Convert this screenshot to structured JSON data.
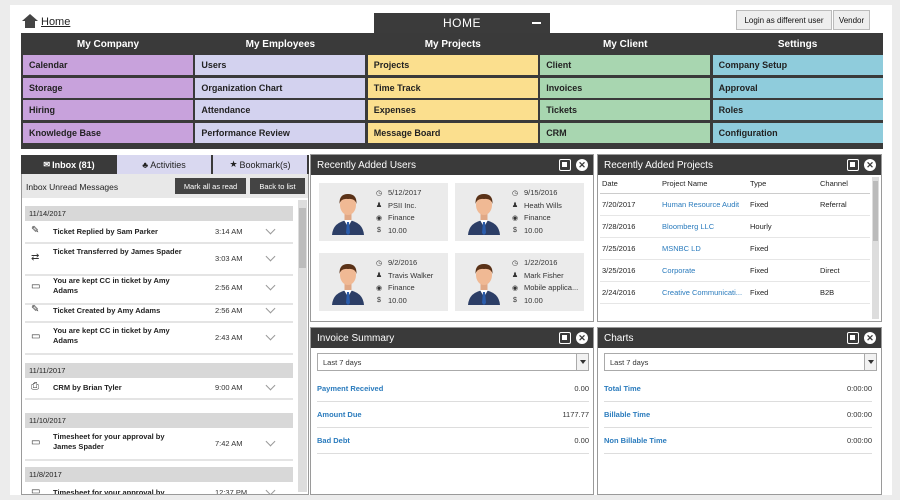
{
  "header": {
    "home_link": "Home",
    "home_tab": "HOME",
    "login_button": "Login as different user",
    "vendor_button": "Vendor"
  },
  "nav": {
    "columns": [
      {
        "title": "My Company",
        "color": "#c8a2dc",
        "items": [
          "Calendar",
          "Storage",
          "Hiring",
          "Knowledge Base"
        ]
      },
      {
        "title": "My Employees",
        "color": "#d3d2ef",
        "items": [
          "Users",
          "Organization Chart",
          "Attendance",
          "Performance Review"
        ]
      },
      {
        "title": "My Projects",
        "color": "#fbdf8e",
        "items": [
          "Projects",
          "Time Track",
          "Expenses",
          "Message Board"
        ]
      },
      {
        "title": "My Client",
        "color": "#a8d6b0",
        "items": [
          "Client",
          "Invoices",
          "Tickets",
          "CRM"
        ]
      },
      {
        "title": "Settings",
        "color": "#8fccdc",
        "items": [
          "Company Setup",
          "Approval",
          "Roles",
          "Configuration"
        ]
      }
    ]
  },
  "inbox": {
    "tabs": [
      "Inbox (81)",
      "Activities",
      "Bookmark(s)"
    ],
    "subtitle": "Inbox Unread Messages",
    "mark_all": "Mark all as read",
    "back": "Back to list",
    "dates": [
      "11/14/2017",
      "11/11/2017",
      "11/10/2017",
      "11/8/2017"
    ],
    "messages": [
      {
        "text": "Ticket Replied by Sam Parker",
        "time": "3:14 AM",
        "icon": "ticket-icon"
      },
      {
        "text": "Ticket Transferred by James Spader",
        "time": "3:03 AM",
        "icon": "ticket-transfer-icon"
      },
      {
        "text": "You are kept CC in ticket by Amy Adams",
        "time": "2:56 AM",
        "icon": "calendar-icon"
      },
      {
        "text": "Ticket Created by Amy Adams",
        "time": "2:56 AM",
        "icon": "ticket-icon"
      },
      {
        "text": "You are kept CC in ticket by Amy Adams",
        "time": "2:43 AM",
        "icon": "calendar-icon"
      },
      {
        "text": "CRM by Brian Tyler",
        "time": "9:00 AM",
        "icon": "crm-icon"
      },
      {
        "text": "Timesheet for your approval by James Spader",
        "time": "7:42 AM",
        "icon": "calendar-icon"
      },
      {
        "text": "Timesheet for your approval by",
        "time": "12:37 PM",
        "icon": "calendar-icon"
      }
    ]
  },
  "users": {
    "title": "Recently Added Users",
    "cards": [
      {
        "date": "5/12/2017",
        "name": "PSII Inc.",
        "dept": "Finance",
        "amount": "10.00"
      },
      {
        "date": "9/15/2016",
        "name": "Heath Wills",
        "dept": "Finance",
        "amount": "10.00"
      },
      {
        "date": "9/2/2016",
        "name": "Travis Walker",
        "dept": "Finance",
        "amount": "10.00"
      },
      {
        "date": "1/22/2016",
        "name": "Mark Fisher",
        "dept": "Mobile applica...",
        "amount": "10.00"
      }
    ]
  },
  "projects": {
    "title": "Recently Added Projects",
    "columns": [
      "Date",
      "Project Name",
      "Type",
      "Channel"
    ],
    "rows": [
      [
        "7/20/2017",
        "Human Resource Audit",
        "Fixed",
        "Referral"
      ],
      [
        "7/28/2016",
        "Bloomberg LLC",
        "Hourly",
        ""
      ],
      [
        "7/25/2016",
        "MSNBC LD",
        "Fixed",
        ""
      ],
      [
        "3/25/2016",
        "Corporate",
        "Fixed",
        "Direct"
      ],
      [
        "2/24/2016",
        "Creative Communicati...",
        "Fixed",
        "B2B"
      ]
    ]
  },
  "invoice": {
    "title": "Invoice Summary",
    "period": "Last 7 days",
    "rows": [
      {
        "label": "Payment Received",
        "value": "0.00"
      },
      {
        "label": "Amount Due",
        "value": "1177.77"
      },
      {
        "label": "Bad Debt",
        "value": "0.00"
      }
    ]
  },
  "charts": {
    "title": "Charts",
    "period": "Last 7 days",
    "rows": [
      {
        "label": "Total Time",
        "value": "0:00:00"
      },
      {
        "label": "Billable Time",
        "value": "0:00:00"
      },
      {
        "label": "Non Billable Time",
        "value": "0:00:00"
      }
    ]
  }
}
